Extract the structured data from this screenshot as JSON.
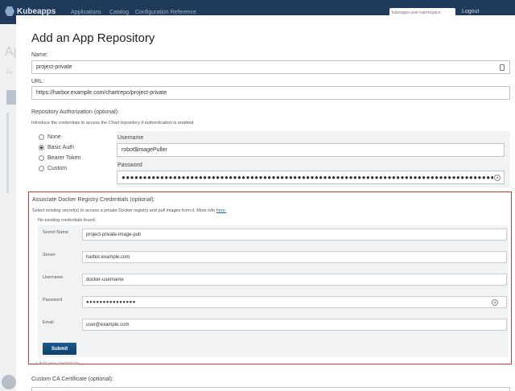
{
  "background": {
    "brand": "Kubeapps",
    "nav": [
      "Applications",
      "Catalog",
      "Configuration Reference"
    ],
    "namespace_placeholder": "kubeapps-user-namespace",
    "user": "Logout"
  },
  "modal": {
    "title": "Add an App Repository",
    "name_label": "Name:",
    "name_value": "project-private",
    "url_label": "URL:",
    "url_value": "https://harbor.example.com/chartrepo/project-private",
    "auth_label": "Repository Authorization (optional):",
    "auth_note": "Introduce the credentials to access the Chart repository if authentication is enabled.",
    "auth_options": [
      "None",
      "Basic Auth",
      "Bearer Token",
      "Custom"
    ],
    "auth_selected": "Basic Auth",
    "username_label": "Username",
    "username_value": "robot$imagePuller",
    "password_label": "Password",
    "password_value": "●●●●●●●●●●●●●●●●●●●●●●●●●●●●●●●●●●●●●●●●●●●●●●●●●●●●●●●●●●●●●●●●●●●●●●●●●●●●●●●●●●●●●●●●●●●●●●●●●●●●●●●●●●●●",
    "docker": {
      "title": "Associate Docker Registry Credentials (optional):",
      "note": "Select existing secret(s) to access a private Docker registry and pull images from it. More info",
      "note_link": "here.",
      "none_text": "No existing credentials found.",
      "secret_name_label": "Secret Name",
      "secret_name_value": "project-private-image-pull",
      "server_label": "Server",
      "server_value": "harbor.example.com",
      "username_label": "Username",
      "username_value": "docker-username",
      "password_label": "Password",
      "password_value": "●●●●●●●●●●●●●●●",
      "email_label": "Email",
      "email_value": "user@example.com",
      "submit_label": "Submit",
      "add_new": "+ Add new credentials"
    },
    "ca_label": "Custom CA Certificate (optional):"
  },
  "colors": {
    "highlight": "#d9352a",
    "button": "#15507f",
    "header": "#1f3a5a"
  }
}
